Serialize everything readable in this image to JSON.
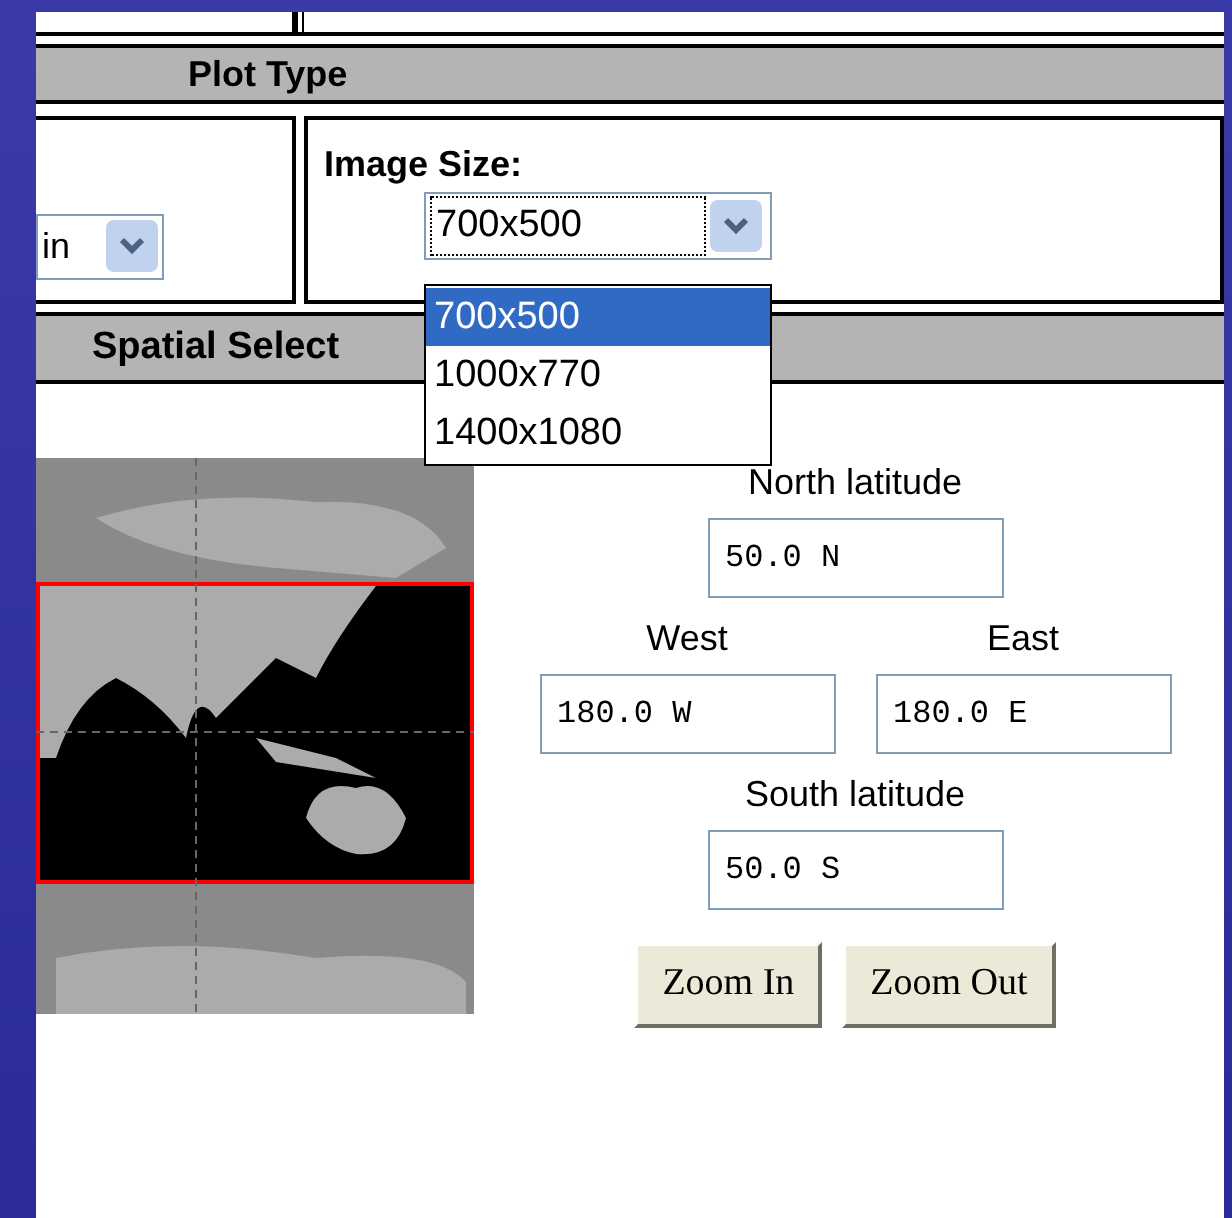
{
  "plot_type_section": {
    "heading": "Plot Type",
    "left_select": {
      "value": "in"
    },
    "image_size": {
      "label": "Image Size:",
      "value": "700x500",
      "expanded": true,
      "options": [
        {
          "label": "700x500",
          "selected": true
        },
        {
          "label": "1000x770",
          "selected": false
        },
        {
          "label": "1400x1080",
          "selected": false
        }
      ]
    }
  },
  "spatial_section": {
    "heading": "Spatial Select",
    "map": {
      "kind": "picture"
    },
    "fields": [
      {
        "label": "North latitude",
        "value": "50.0 N"
      },
      {
        "label": "West",
        "value": "180.0 W"
      },
      {
        "label": "East",
        "value": "180.0 E"
      },
      {
        "label": "South latitude",
        "value": "50.0 S"
      }
    ],
    "buttons": [
      "Zoom In",
      "Zoom Out"
    ]
  }
}
